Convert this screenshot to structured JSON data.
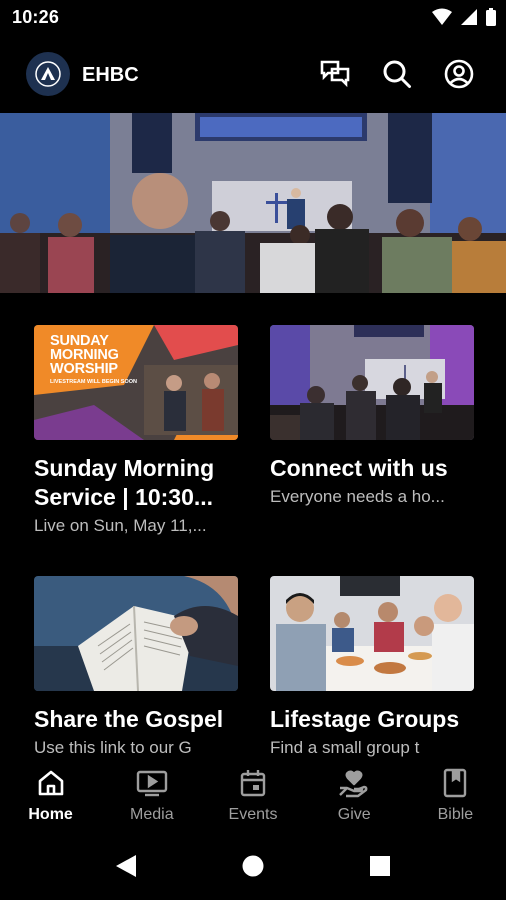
{
  "status": {
    "time": "10:26"
  },
  "header": {
    "title": "EHBC"
  },
  "hero": {
    "alt": "Worship service congregation"
  },
  "cards": [
    {
      "title": "Sunday Morning",
      "title2": "Service | 10:30...",
      "subtitle": "Live on Sun, May 11,...",
      "thumb_heading": "SUNDAY MORNING WORSHIP",
      "thumb_sub": "LIVESTREAM WILL BEGIN SOON"
    },
    {
      "title": "Connect with us",
      "subtitle": "Everyone needs a ho..."
    },
    {
      "title": "Share the Gospel",
      "subtitle": "Use this link to our G"
    },
    {
      "title": "Lifestage Groups",
      "subtitle": "Find a small group t"
    }
  ],
  "nav": {
    "items": [
      {
        "label": "Home",
        "icon": "home-icon",
        "active": true
      },
      {
        "label": "Media",
        "icon": "media-icon",
        "active": false
      },
      {
        "label": "Events",
        "icon": "calendar-icon",
        "active": false
      },
      {
        "label": "Give",
        "icon": "give-icon",
        "active": false
      },
      {
        "label": "Bible",
        "icon": "bible-icon",
        "active": false
      }
    ]
  },
  "colors": {
    "background": "#000000",
    "logo_bg": "#1e3150",
    "subtitle": "#bdbdbd",
    "inactive_nav": "#9e9e9e"
  }
}
